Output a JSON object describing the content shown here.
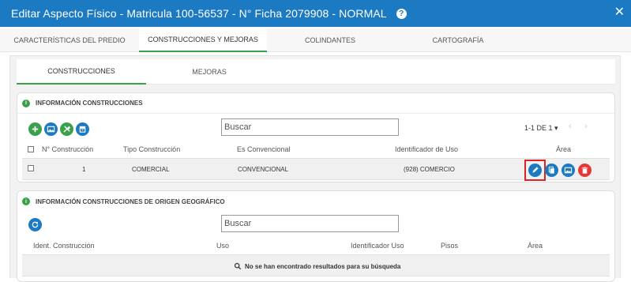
{
  "window": {
    "title": "Editar Aspecto Físico - Matricula 100-56537 - N° Ficha 2079908 - NORMAL",
    "help_icon": "question-icon",
    "close_icon": "close-icon"
  },
  "main_tabs": [
    {
      "label": "CARACTERÍSTICAS DEL PREDIO",
      "active": false
    },
    {
      "label": "CONSTRUCCIONES Y MEJORAS",
      "active": true
    },
    {
      "label": "COLINDANTES",
      "active": false
    },
    {
      "label": "CARTOGRAFÍA",
      "active": false
    }
  ],
  "sub_tabs": [
    {
      "label": "CONSTRUCCIONES",
      "active": true
    },
    {
      "label": "MEJORAS",
      "active": false
    }
  ],
  "construcciones": {
    "title": "INFORMACIÓN CONSTRUCCIONES",
    "search_placeholder": "Buscar",
    "pager": "1-1 DE 1",
    "toolbar_icons": [
      "add-icon",
      "image-icon",
      "tools-icon",
      "archive-icon"
    ],
    "columns": [
      "N° Construcción",
      "Tipo Construcción",
      "Es Convencional",
      "Identificador de Uso",
      "Área"
    ],
    "rows": [
      {
        "numero": "1",
        "tipo": "COMERCIAL",
        "convencional": "CONVENCIONAL",
        "uso": "(928) COMERCIO",
        "area": ""
      }
    ],
    "row_actions": [
      "edit-icon",
      "copy-icon",
      "image-icon",
      "delete-icon"
    ]
  },
  "origen_geografico": {
    "title": "INFORMACIÓN CONSTRUCCIONES DE ORIGEN GEOGRÁFICO",
    "search_placeholder": "Buscar",
    "columns": [
      "Ident. Construcción",
      "Uso",
      "Identificador Uso",
      "Pisos",
      "Área"
    ],
    "empty_message": "No se han encontrado resultados para su búsqueda"
  },
  "colors": {
    "primary": "#1b7ac2",
    "success": "#3aa14a",
    "danger": "#e53935",
    "highlight": "#dd2222"
  }
}
